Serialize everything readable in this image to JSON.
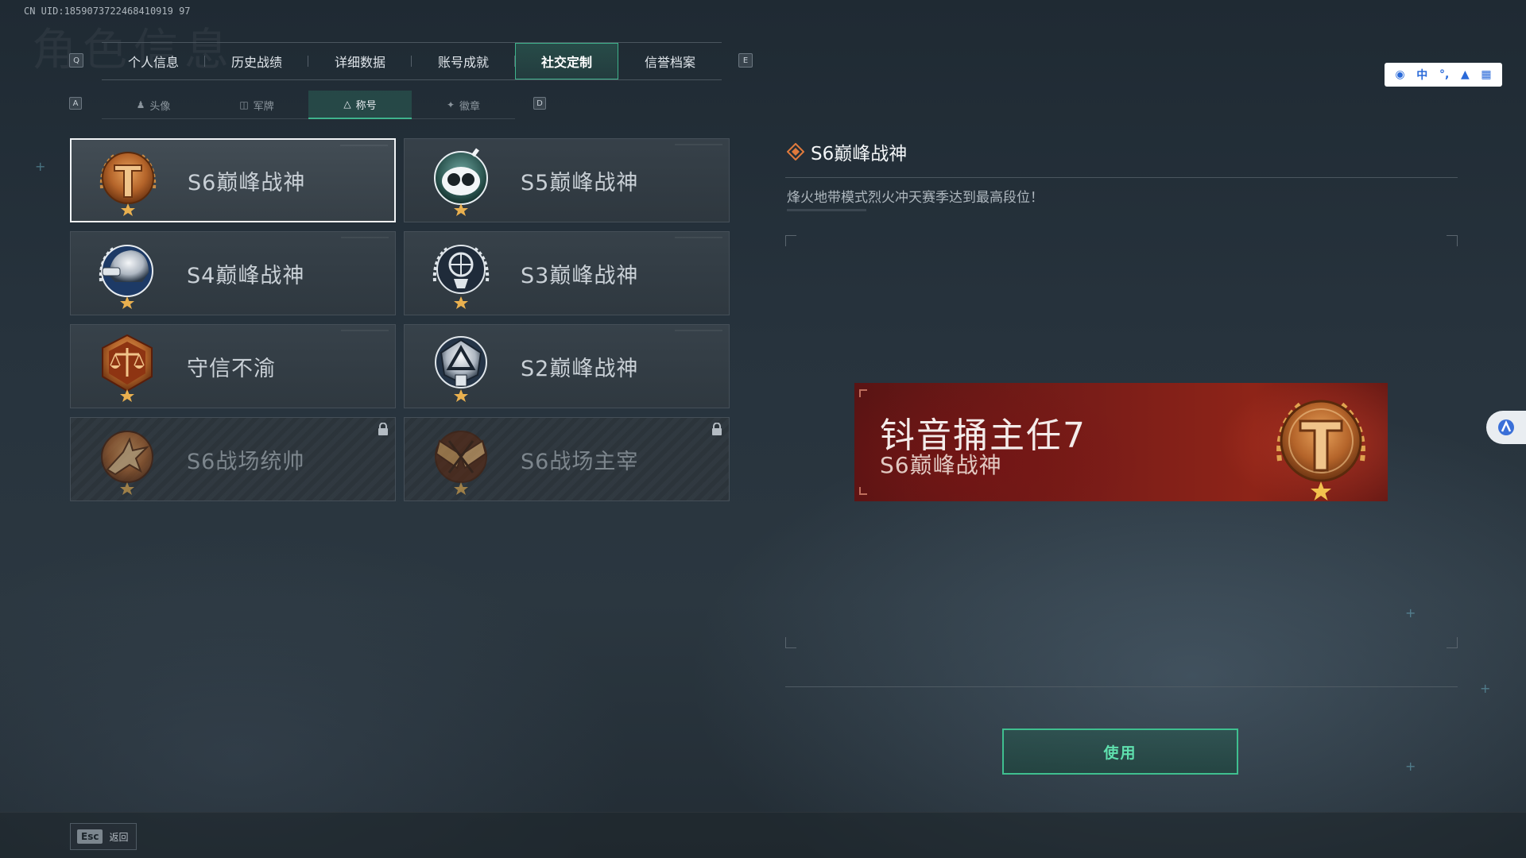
{
  "uid": "CN UID:1859073722468410919 97",
  "bg_title": "角色信息",
  "top_tabs": {
    "left_key": "Q",
    "right_key": "E",
    "items": [
      {
        "label": "个人信息"
      },
      {
        "label": "历史战绩"
      },
      {
        "label": "详细数据"
      },
      {
        "label": "账号成就"
      },
      {
        "label": "社交定制"
      },
      {
        "label": "信誉档案"
      }
    ],
    "active_index": 4
  },
  "sub_tabs": {
    "left_key": "A",
    "right_key": "D",
    "items": [
      {
        "label": "头像",
        "icon": "person-icon"
      },
      {
        "label": "军牌",
        "icon": "dogtag-icon"
      },
      {
        "label": "称号",
        "icon": "title-icon"
      },
      {
        "label": "徽章",
        "icon": "badge-icon"
      }
    ],
    "active_index": 2
  },
  "titles": [
    {
      "name": "S6巅峰战神",
      "emblem": "s6-peak-emblem",
      "selected": true,
      "locked": false
    },
    {
      "name": "S5巅峰战神",
      "emblem": "s5-peak-emblem",
      "selected": false,
      "locked": false
    },
    {
      "name": "S4巅峰战神",
      "emblem": "s4-peak-emblem",
      "selected": false,
      "locked": false
    },
    {
      "name": "S3巅峰战神",
      "emblem": "s3-peak-emblem",
      "selected": false,
      "locked": false
    },
    {
      "name": "守信不渝",
      "emblem": "scales-emblem",
      "selected": false,
      "locked": false
    },
    {
      "name": "S2巅峰战神",
      "emblem": "s2-peak-emblem",
      "selected": false,
      "locked": false
    },
    {
      "name": "S6战场统帅",
      "emblem": "jet-emblem",
      "selected": false,
      "locked": true
    },
    {
      "name": "S6战场主宰",
      "emblem": "crossed-flags-emblem",
      "selected": false,
      "locked": true
    }
  ],
  "detail": {
    "title": "S6巅峰战神",
    "description": "烽火地带模式烈火冲天赛季达到最高段位！"
  },
  "banner": {
    "player_name": "钭音捅主任7",
    "title": "S6巅峰战神"
  },
  "use_button": "使用",
  "footer": {
    "esc_key": "Esc",
    "esc_label": "返回"
  },
  "ime": {
    "mode": "中"
  },
  "colors": {
    "accent_green": "#3fb38c",
    "banner_red": "#7a1d18",
    "emblem_bronze": "#c07a3a"
  }
}
